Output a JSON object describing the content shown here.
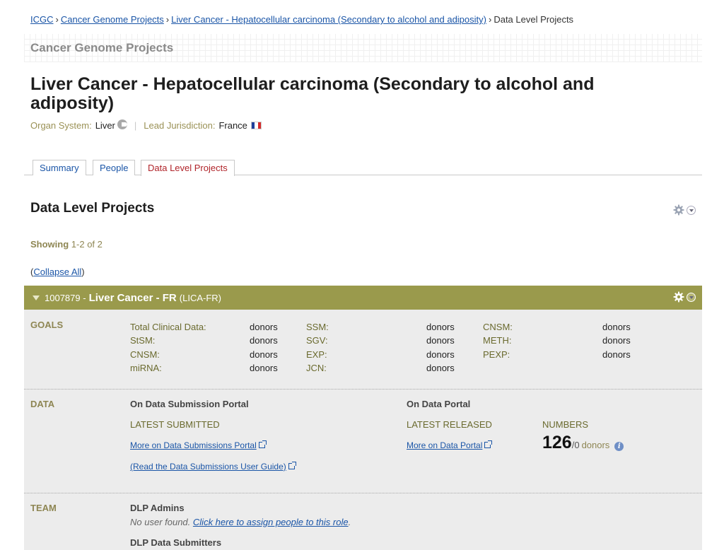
{
  "breadcrumb": {
    "items": [
      "ICGC",
      "Cancer Genome Projects",
      "Liver Cancer - Hepatocellular carcinoma (Secondary to alcohol and adiposity)"
    ],
    "current": "Data Level Projects",
    "separator": "›"
  },
  "banner": {
    "title": "Cancer Genome Projects"
  },
  "page": {
    "title": "Liver Cancer - Hepatocellular carcinoma (Secondary to alcohol and adiposity)",
    "organ_label": "Organ System:",
    "organ_value": "Liver",
    "jurisdiction_label": "Lead Jurisdiction:",
    "jurisdiction_value": "France",
    "separator": "|"
  },
  "tabs": [
    {
      "label": "Summary",
      "active": false
    },
    {
      "label": "People",
      "active": false
    },
    {
      "label": "Data Level Projects",
      "active": true
    }
  ],
  "section": {
    "title": "Data Level Projects",
    "showing_label": "Showing",
    "showing_range": "1-2 of 2",
    "collapse_open": "(",
    "collapse_link": "Collapse All",
    "collapse_close": ")"
  },
  "project": {
    "id": "1007879 -",
    "name": "Liver Cancer - FR",
    "code": "(LICA-FR)",
    "goals_label": "GOALS",
    "goals": [
      [
        {
          "label": "Total Clinical Data:",
          "value": "donors"
        },
        {
          "label": "SSM:",
          "value": "donors"
        },
        {
          "label": "CNSM:",
          "value": "donors"
        }
      ],
      [
        {
          "label": "StSM:",
          "value": "donors"
        },
        {
          "label": "SGV:",
          "value": "donors"
        },
        {
          "label": "METH:",
          "value": "donors"
        }
      ],
      [
        {
          "label": "CNSM:",
          "value": "donors"
        },
        {
          "label": "EXP:",
          "value": "donors"
        },
        {
          "label": "PEXP:",
          "value": "donors"
        }
      ],
      [
        {
          "label": "miRNA:",
          "value": "donors"
        },
        {
          "label": "JCN:",
          "value": "donors"
        }
      ]
    ],
    "data_label": "DATA",
    "data": {
      "submission_title": "On Data Submission Portal",
      "latest_submitted": "LATEST SUBMITTED",
      "more_submissions": "More on Data Submissions Portal",
      "user_guide": "(Read the Data Submissions User Guide)",
      "portal_title": "On Data Portal",
      "latest_released": "LATEST RELEASED",
      "numbers_label": "NUMBERS",
      "more_portal": "More on Data Portal",
      "donor_count": "126",
      "donor_total": "/0",
      "donor_word": "donors"
    },
    "team_label": "TEAM",
    "team": {
      "admins_title": "DLP Admins",
      "no_user": "No user found.",
      "assign_link": "Click here to assign people to this role",
      "period": ".",
      "submitters_title": "DLP Data Submitters"
    }
  },
  "colors": {
    "link": "#1a55a7",
    "active_tab": "#b0242a",
    "olive_header": "#9a9a4c",
    "olive_text": "#8e8653",
    "panel_bg": "#ececec"
  },
  "icons": {
    "organ": "organ-info-icon",
    "flag": "france-flag-icon",
    "gear": "gear-icon",
    "dropdown": "chevron-down-icon",
    "expand": "triangle-down-icon",
    "external": "external-link-icon",
    "info": "info-icon"
  }
}
